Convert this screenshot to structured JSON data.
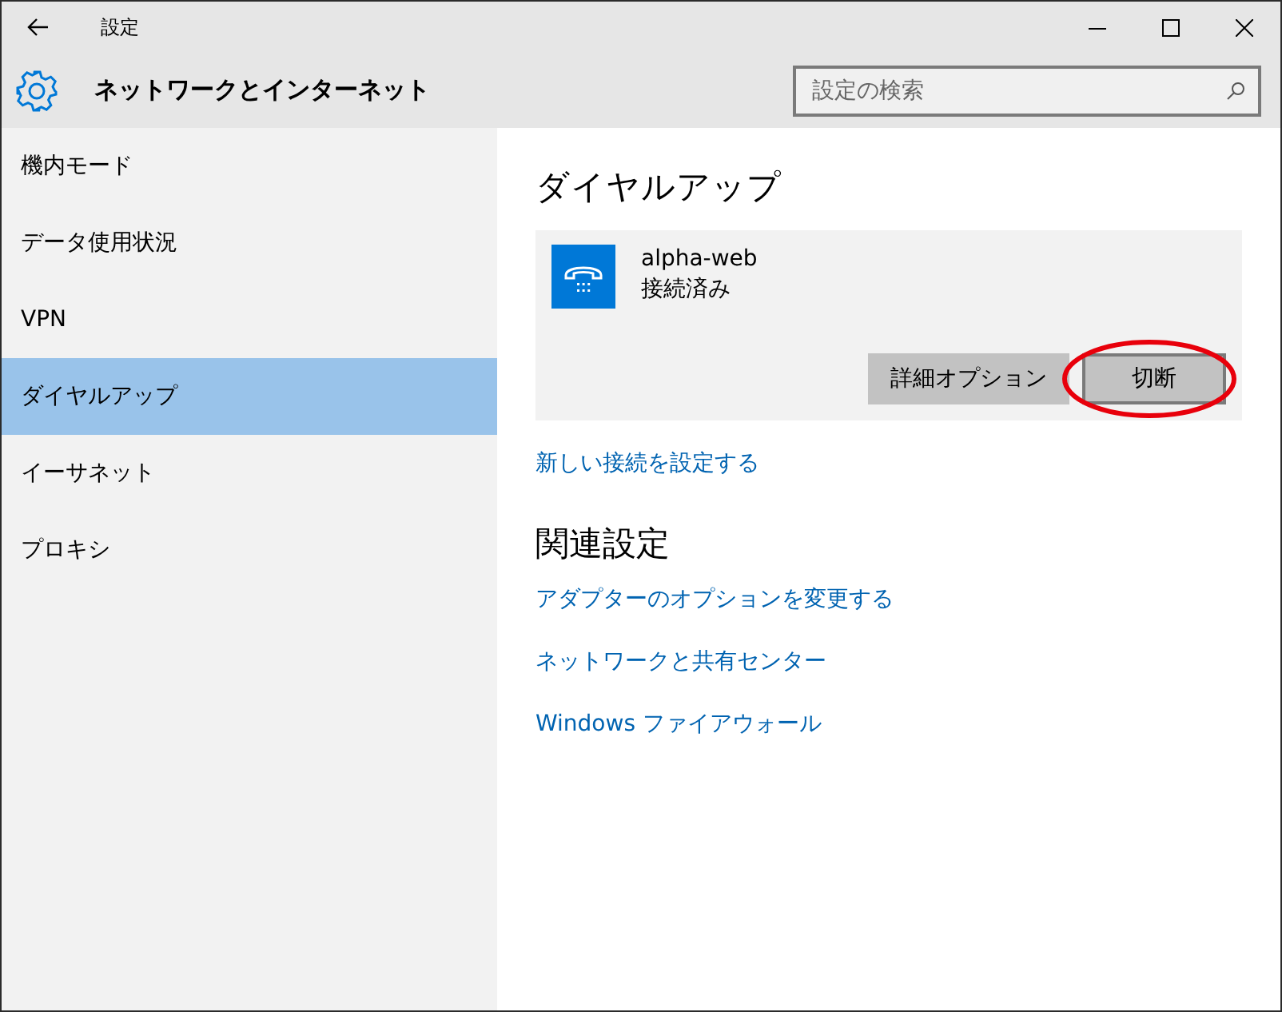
{
  "window": {
    "title": "設定"
  },
  "header": {
    "title": "ネットワークとインターネット",
    "search": {
      "placeholder": "設定の検索"
    }
  },
  "sidebar": {
    "items": [
      {
        "label": "機内モード",
        "selected": false
      },
      {
        "label": "データ使用状況",
        "selected": false
      },
      {
        "label": "VPN",
        "selected": false
      },
      {
        "label": "ダイヤルアップ",
        "selected": true
      },
      {
        "label": "イーサネット",
        "selected": false
      },
      {
        "label": "プロキシ",
        "selected": false
      }
    ]
  },
  "content": {
    "title": "ダイヤルアップ",
    "connection": {
      "name": "alpha-web",
      "status": "接続済み",
      "buttons": [
        {
          "label": "詳細オプション",
          "highlighted": false
        },
        {
          "label": "切断",
          "highlighted": true
        }
      ]
    },
    "new_link": "新しい接続を設定する",
    "related_title": "関連設定",
    "related_links": [
      "アダプターのオプションを変更する",
      "ネットワークと共有センター",
      "Windows ファイアウォール"
    ]
  }
}
